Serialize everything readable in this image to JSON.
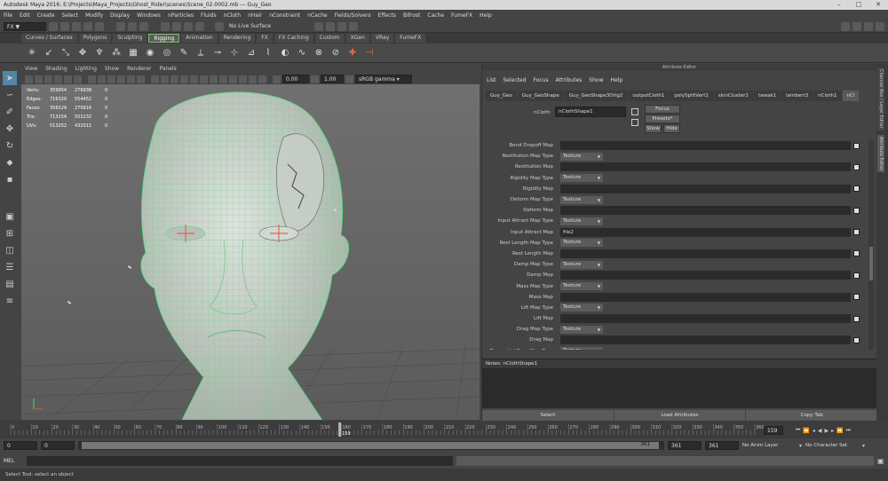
{
  "window": {
    "title": "Autodesk Maya 2016: E:\\Projects\\Maya_Projects\\Ghost_Rider\\scenes\\Scene_02.0002.mb  ---  Guy_Geo"
  },
  "menubar": [
    "File",
    "Edit",
    "Create",
    "Select",
    "Modify",
    "Display",
    "Windows",
    "nParticles",
    "Fluids",
    "nCloth",
    "nHair",
    "nConstraint",
    "nCache",
    "Fields/Solvers",
    "Effects",
    "Bifrost",
    "Cache",
    "FumeFX",
    "Help"
  ],
  "statusline": {
    "menuset": "FX",
    "live_surface": "No Live Surface"
  },
  "shelf": {
    "tabs": [
      "Curves / Surfaces",
      "Polygons",
      "Sculpting",
      "Rigging",
      "Animation",
      "Rendering",
      "FX",
      "FX Caching",
      "Custom",
      "XGen",
      "VRay",
      "FumeFX"
    ],
    "active_tab": "Rigging"
  },
  "viewport": {
    "menu": [
      "View",
      "Shading",
      "Lighting",
      "Show",
      "Renderer",
      "Panels"
    ],
    "toolbar": {
      "field1": "0.00",
      "field2": "1.00",
      "colorspace": "sRGB gamma"
    },
    "hud": [
      {
        "label": "Verts:",
        "a": "359954",
        "b": "276938",
        "c": "0"
      },
      {
        "label": "Edges:",
        "a": "716320",
        "b": "554452",
        "c": "0"
      },
      {
        "label": "Faces:",
        "a": "356524",
        "b": "275616",
        "c": "0"
      },
      {
        "label": "Tris:",
        "a": "713154",
        "b": "551232",
        "c": "0"
      },
      {
        "label": "UVs:",
        "a": "513252",
        "b": "432011",
        "c": "0"
      }
    ]
  },
  "attribute_editor": {
    "title": "Attribute Editor",
    "menu": [
      "List",
      "Selected",
      "Focus",
      "Attributes",
      "Show",
      "Help"
    ],
    "tabs": [
      "Guy_Geo",
      "Guy_GeoShape",
      "Guy_GeoShape3Orig2",
      "outputCloth1",
      "polySplitVert1",
      "skinCluster1",
      "tweak1",
      "lambert3",
      "nCloth1",
      "nCl"
    ],
    "active_tab": "nCl",
    "ncloth_label": "nCloth:",
    "ncloth_value": "nClothShape1",
    "buttons": {
      "focus": "Focus",
      "presets": "Presets*",
      "show": "Show",
      "hide": "Hide"
    },
    "rows": [
      {
        "label": "Bend Dropoff Map",
        "type": "map",
        "value": ""
      },
      {
        "label": "Restitution Map Type",
        "type": "select",
        "value": "Texture"
      },
      {
        "label": "Restitution Map",
        "type": "map",
        "value": ""
      },
      {
        "label": "Rigidity Map Type",
        "type": "select",
        "value": "Texture"
      },
      {
        "label": "Rigidity Map",
        "type": "map",
        "value": ""
      },
      {
        "label": "Deform Map Type",
        "type": "select",
        "value": "Texture"
      },
      {
        "label": "Deform Map",
        "type": "map",
        "value": ""
      },
      {
        "label": "Input Attract Map Type",
        "type": "select",
        "value": "Texture"
      },
      {
        "label": "Input Attract Map",
        "type": "map",
        "value": "file2"
      },
      {
        "label": "Rest Length Map Type",
        "type": "select",
        "value": "Texture"
      },
      {
        "label": "Rest Length Map",
        "type": "map",
        "value": ""
      },
      {
        "label": "Damp Map Type",
        "type": "select",
        "value": "Texture"
      },
      {
        "label": "Damp Map",
        "type": "map",
        "value": ""
      },
      {
        "label": "Mass Map Type",
        "type": "select",
        "value": "Texture"
      },
      {
        "label": "Mass Map",
        "type": "map",
        "value": ""
      },
      {
        "label": "Lift Map Type",
        "type": "select",
        "value": "Texture"
      },
      {
        "label": "Lift Map",
        "type": "map",
        "value": ""
      },
      {
        "label": "Drag Map Type",
        "type": "select",
        "value": "Texture"
      },
      {
        "label": "Drag Map",
        "type": "map",
        "value": ""
      },
      {
        "label": "Tangential Drag Map Type",
        "type": "select",
        "value": "Texture"
      }
    ],
    "notes_label": "Notes:  nClothShape1",
    "bottom_buttons": [
      "Select",
      "Load Attributes",
      "Copy Tab"
    ]
  },
  "side_tabs": [
    "Channel Box / Layer Editor",
    "Attribute Editor"
  ],
  "timeslider": {
    "ticks": [
      "0",
      "10",
      "20",
      "30",
      "40",
      "50",
      "60",
      "70",
      "80",
      "90",
      "100",
      "110",
      "120",
      "130",
      "140",
      "150",
      "160",
      "170",
      "180",
      "190",
      "200",
      "210",
      "220",
      "230",
      "240",
      "250",
      "260",
      "270",
      "280",
      "290",
      "300",
      "310",
      "320",
      "330",
      "340",
      "350",
      "360"
    ],
    "current_frame": "159",
    "current_frame_field": "159"
  },
  "range": {
    "start": "0",
    "anim_start": "0",
    "range_end": "361",
    "anim_end": "361",
    "end_field": "361",
    "anim_layer": "No Anim Layer",
    "char_set": "No Character Set"
  },
  "cmdline": {
    "label": "MEL"
  },
  "helpline": {
    "text": "Select Tool: select an object"
  }
}
